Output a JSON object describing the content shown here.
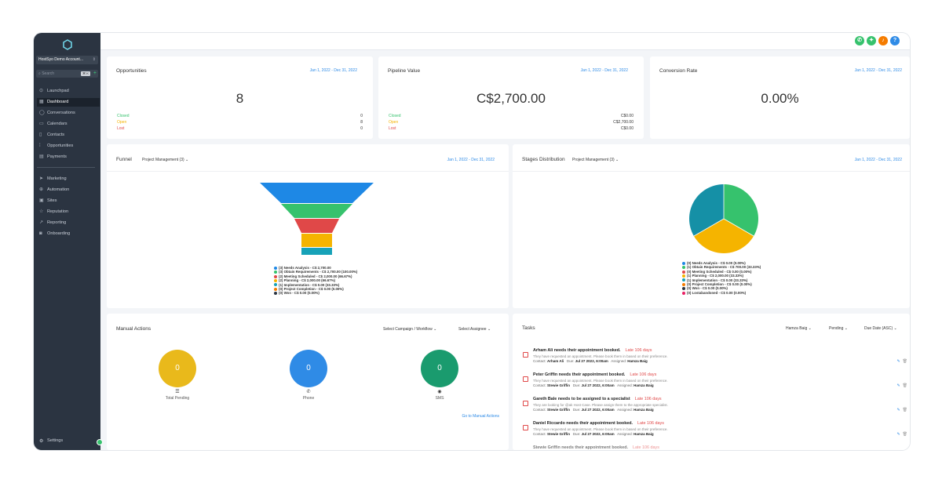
{
  "sidebar": {
    "account": "HostSyo Demo Account...",
    "search_placeholder": "Search",
    "search_shortcut": "⌘ K",
    "items": [
      {
        "label": "Launchpad",
        "icon": "rocket-icon"
      },
      {
        "label": "Dashboard",
        "icon": "dashboard-icon"
      },
      {
        "label": "Conversations",
        "icon": "chat-icon"
      },
      {
        "label": "Calendars",
        "icon": "calendar-icon"
      },
      {
        "label": "Contacts",
        "icon": "contacts-icon"
      },
      {
        "label": "Opportunities",
        "icon": "opportunities-icon"
      },
      {
        "label": "Payments",
        "icon": "payments-icon"
      },
      {
        "label": "Marketing",
        "icon": "send-icon"
      },
      {
        "label": "Automation",
        "icon": "automation-icon"
      },
      {
        "label": "Sites",
        "icon": "sites-icon"
      },
      {
        "label": "Reputation",
        "icon": "star-icon"
      },
      {
        "label": "Reporting",
        "icon": "chart-icon"
      },
      {
        "label": "Onboarding",
        "icon": "onboarding-icon"
      }
    ],
    "settings": "Settings"
  },
  "opportunities": {
    "title": "Opportunities",
    "date": "Jan 1, 2022 - Dec 31, 2022",
    "value": "8",
    "rows": [
      {
        "label": "Closed",
        "value": "0",
        "color": "#36c26d"
      },
      {
        "label": "Open",
        "value": "8",
        "color": "#f5b400"
      },
      {
        "label": "Lost",
        "value": "0",
        "color": "#e04848"
      }
    ]
  },
  "pipeline": {
    "title": "Pipeline Value",
    "date": "Jan 1, 2022 - Dec 31, 2022",
    "value": "C$2,700.00",
    "rows": [
      {
        "label": "Closed",
        "value": "C$0.00",
        "color": "#36c26d"
      },
      {
        "label": "Open",
        "value": "C$2,700.00",
        "color": "#f5b400"
      },
      {
        "label": "Lost",
        "value": "C$0.00",
        "color": "#e04848"
      }
    ]
  },
  "conversion": {
    "title": "Conversion Rate",
    "date": "Jan 1, 2022 - Dec 31, 2022",
    "value": "0.00%"
  },
  "funnel": {
    "title": "Funnel",
    "pipeline": "Project Management (3)",
    "date": "Jan 1, 2022 - Dec 31, 2022",
    "legend": [
      {
        "label": "(3) Needs Analysis - C$ 2,700.00",
        "color": "#1e88e5"
      },
      {
        "label": "(3) Obtain Requirements - C$ 2,700.00 (100.00%)",
        "color": "#36c26d"
      },
      {
        "label": "(2) Meeting Scheduled - C$ 2,000.00 (66.67%)",
        "color": "#e04848"
      },
      {
        "label": "(2) Planning - C$ 2,000.00 (66.67%)",
        "color": "#f5b400"
      },
      {
        "label": "(1) Implementation - C$ 0.00 (33.33%)",
        "color": "#17a2b8"
      },
      {
        "label": "(0) Project Completion - C$ 0.00 (0.00%)",
        "color": "#f57c00"
      },
      {
        "label": "(0) Won - C$ 0.00 (0.00%)",
        "color": "#2b3441"
      }
    ]
  },
  "stages": {
    "title": "Stages Distribution",
    "pipeline": "Project Management (3)",
    "date": "Jan 1, 2022 - Dec 31, 2022",
    "legend": [
      {
        "label": "(0) Needs Analysis - C$ 0.00 (0.00%)",
        "color": "#1e88e5"
      },
      {
        "label": "(1) Obtain Requirements - C$ 700.00 (33.33%)",
        "color": "#36c26d"
      },
      {
        "label": "(0) Meeting Scheduled - C$ 0.00 (0.00%)",
        "color": "#e04848"
      },
      {
        "label": "(1) Planning - C$ 2,000.00 (33.33%)",
        "color": "#f5b400"
      },
      {
        "label": "(1) Implementation - C$ 0.00 (33.33%)",
        "color": "#17a2b8"
      },
      {
        "label": "(0) Project Completion - C$ 0.00 (0.00%)",
        "color": "#f57c00"
      },
      {
        "label": "(0) Won - C$ 0.00 (0.00%)",
        "color": "#2b3441"
      },
      {
        "label": "(0) Lostabandoned - C$ 0.00 (0.00%)",
        "color": "#e91e63"
      }
    ]
  },
  "manual_actions": {
    "title": "Manual Actions",
    "campaign_select": "Select Campaign / Workflow",
    "assignee_select": "Select Assignee",
    "items": [
      {
        "value": "0",
        "label": "Total Pending",
        "icon": "list-icon",
        "color": "#e9b91b"
      },
      {
        "value": "0",
        "label": "Phone",
        "icon": "phone-icon",
        "color": "#2f8be6"
      },
      {
        "value": "0",
        "label": "SMS",
        "icon": "sms-icon",
        "color": "#1a9b6e"
      }
    ],
    "link": "Go to Manual Actions"
  },
  "tasks": {
    "title": "Tasks",
    "filter_user": "Hamza Baig",
    "filter_status": "Pending",
    "sort": "Due Date (ASC)",
    "items": [
      {
        "title": "Arham Ali needs their appointment booked.",
        "late": "Late 106 days",
        "desc": "They have requested an appointment. Please book them in based on their preference.",
        "contact": "Arham Ali",
        "due": "Jul 27 2022, 6:00am",
        "assigned": "Hamza Baig"
      },
      {
        "title": "Peter Griffin needs their appointment booked.",
        "late": "Late 106 days",
        "desc": "They have requested an appointment. Please book them in based on their preference.",
        "contact": "Stewie Griffin",
        "due": "Jul 27 2022, 6:00am",
        "assigned": "Hamza Baig"
      },
      {
        "title": "Gareth Bale needs to be assigned to a specialist",
        "late": "Late 106 days",
        "desc": "They are looking for @ak Host Case. Please assign them to the appropriate specialist.",
        "contact": "Stewie Griffin",
        "due": "Jul 27 2022, 6:00am",
        "assigned": "Hamza Baig"
      },
      {
        "title": "Daniel Riccardo needs their appointment booked.",
        "late": "Late 106 days",
        "desc": "They have requested an appointment. Please book them in based on their preference.",
        "contact": "Stewie Griffin",
        "due": "Jul 27 2022, 6:00am",
        "assigned": "Hamza Baig"
      },
      {
        "title": "Stewie Griffin needs their appointment booked.",
        "late": "Late 106 days",
        "desc": "",
        "contact": "",
        "due": "",
        "assigned": ""
      }
    ],
    "labels": {
      "contact": "Contact:",
      "due": "Due:",
      "assigned": "Assigned:"
    }
  },
  "stage_values": {
    "funnel_counts": [
      3,
      3,
      2,
      2,
      1,
      0,
      0
    ],
    "pie_counts": [
      0,
      1,
      0,
      1,
      1,
      0,
      0,
      0
    ]
  }
}
